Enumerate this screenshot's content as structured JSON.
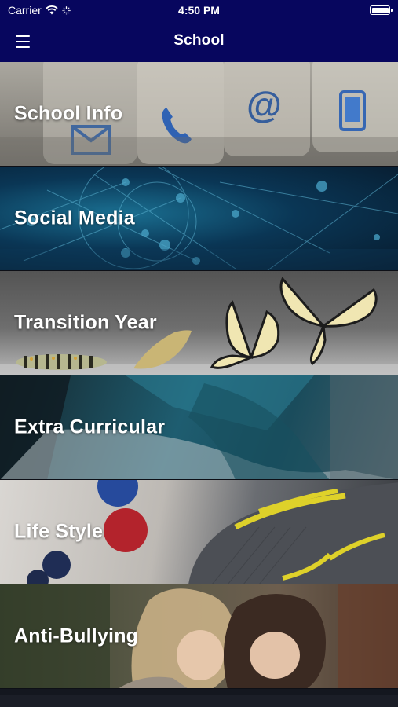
{
  "status_bar": {
    "carrier": "Carrier",
    "time": "4:50 PM",
    "battery_level": 1.0
  },
  "nav": {
    "title": "School",
    "menu_icon": "hamburger-menu-icon",
    "bar_color": "#07065e"
  },
  "menu": {
    "items": [
      {
        "label": "School Info"
      },
      {
        "label": "Social Media"
      },
      {
        "label": "Transition Year"
      },
      {
        "label": "Extra Curricular"
      },
      {
        "label": "Life Style"
      },
      {
        "label": "Anti-Bullying"
      }
    ]
  }
}
